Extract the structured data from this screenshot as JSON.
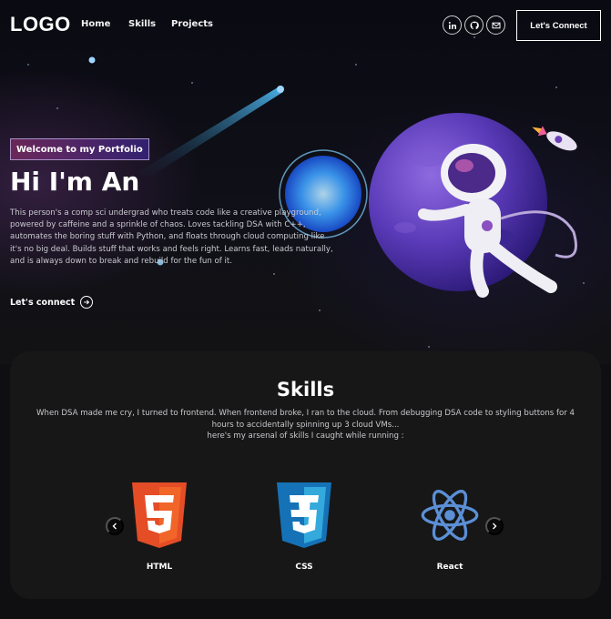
{
  "nav": {
    "logo": "LOGO",
    "links": [
      "Home",
      "Skills",
      "Projects"
    ],
    "social": [
      "linkedin-icon",
      "github-icon",
      "mail-icon"
    ],
    "connect_label": "Let's Connect"
  },
  "hero": {
    "tagline": "Welcome to my Portfolio",
    "title": "Hi I'm An",
    "description": "This person's a comp sci undergrad who treats code like a creative playground, powered by caffeine and a sprinkle of chaos. Loves tackling DSA with C++, automates the boring stuff with Python, and floats through cloud computing like it's no big deal. Builds stuff that works and feels right. Learns fast, leads naturally, and is always down to break and rebuild for the fun of it.",
    "cta": "Let's connect"
  },
  "skills": {
    "title": "Skills",
    "description_line1": "When DSA made me cry, I turned to frontend. When frontend broke, I ran to the cloud. From debugging DSA code to styling buttons for 4 hours to accidentally spinning up 3 cloud VMs...",
    "description_line2": "here's my arsenal of skills I caught while running :",
    "items": [
      {
        "label": "HTML",
        "icon": "html5-icon"
      },
      {
        "label": "CSS",
        "icon": "css3-icon"
      },
      {
        "label": "React",
        "icon": "react-icon"
      }
    ]
  },
  "colors": {
    "background": "#0f0f12",
    "card": "#171717",
    "accent_pink": "#aa367c",
    "accent_purple": "#4a2fbd",
    "html": "#e44d26",
    "css": "#1572b6",
    "react": "#5b8fd6"
  }
}
